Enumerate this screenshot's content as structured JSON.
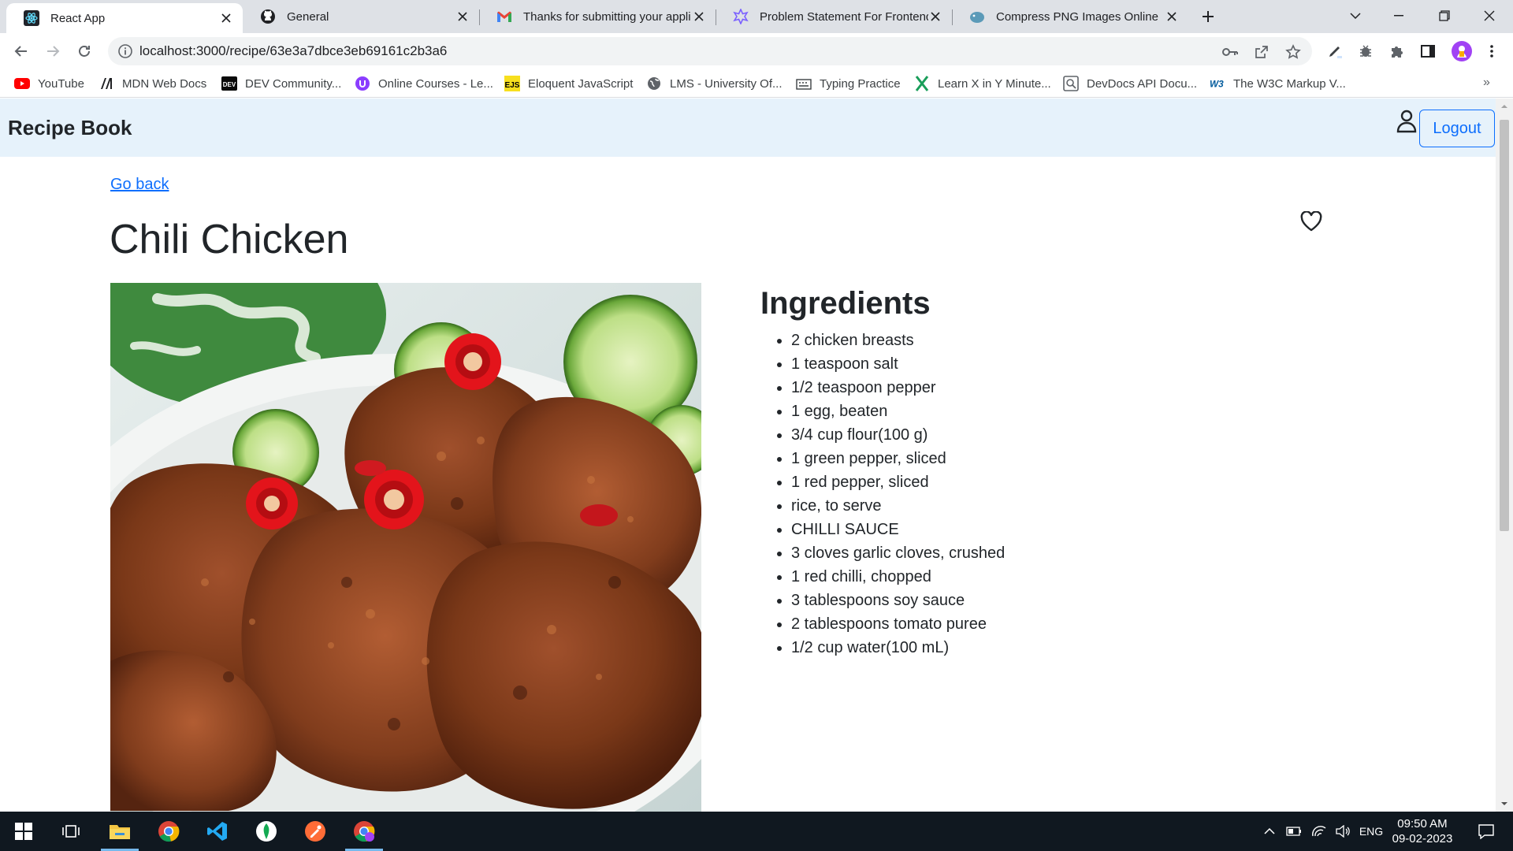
{
  "browser": {
    "tabs": [
      {
        "title": "React App",
        "icon": "react-icon",
        "active": true
      },
      {
        "title": "General",
        "icon": "github-icon",
        "active": false
      },
      {
        "title": "Thanks for submitting your appli",
        "icon": "gmail-icon",
        "active": false
      },
      {
        "title": "Problem Statement For Frontend",
        "icon": "problem-statement-icon",
        "active": false
      },
      {
        "title": "Compress PNG Images Online",
        "icon": "compress-png-icon",
        "active": false
      }
    ],
    "url": "localhost:3000/recipe/63e3a7dbce3eb69161c2b3a6",
    "bookmarks": [
      {
        "label": "YouTube",
        "icon": "youtube-icon"
      },
      {
        "label": "MDN Web Docs",
        "icon": "mdn-icon"
      },
      {
        "label": "DEV Community...",
        "icon": "dev-icon"
      },
      {
        "label": "Online Courses - Le...",
        "icon": "courses-icon"
      },
      {
        "label": "Eloquent JavaScript",
        "icon": "ejs-icon"
      },
      {
        "label": "LMS - University Of...",
        "icon": "globe-icon"
      },
      {
        "label": "Typing Practice",
        "icon": "typing-icon"
      },
      {
        "label": "Learn X in Y Minute...",
        "icon": "learnx-icon"
      },
      {
        "label": "DevDocs API Docu...",
        "icon": "devdocs-icon"
      },
      {
        "label": "The W3C Markup V...",
        "icon": "w3c-icon"
      }
    ]
  },
  "app": {
    "brand": "Recipe Book",
    "logout_label": "Logout",
    "goback_label": "Go back",
    "recipe_title": "Chili Chicken",
    "ingredients_title": "Ingredients",
    "ingredients": [
      "2 chicken breasts",
      "1 teaspoon salt",
      "1/2 teaspoon pepper",
      "1 egg, beaten",
      "3/4 cup flour(100 g)",
      "1 green pepper, sliced",
      "1 red pepper, sliced",
      "rice, to serve",
      "CHILLI SAUCE",
      "3 cloves garlic cloves, crushed",
      "1 red chilli, chopped",
      "3 tablespoons soy sauce",
      "2 tablespoons tomato puree",
      "1/2 cup water(100 mL)"
    ]
  },
  "taskbar": {
    "language": "ENG",
    "time": "09:50 AM",
    "date": "09-02-2023"
  },
  "colors": {
    "accent": "#0d6efd",
    "navbar_bg": "#e6f2fb",
    "tabstrip_bg": "#dee1e6",
    "taskbar_bg": "#101820"
  }
}
